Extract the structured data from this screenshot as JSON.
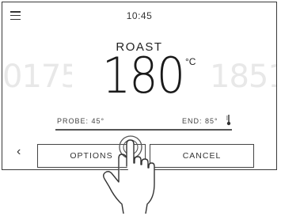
{
  "header": {
    "time": "10:45"
  },
  "mode": "ROAST",
  "temperature": {
    "current": "180",
    "unit": "°C",
    "prev": "0175",
    "next": "1851"
  },
  "probe": {
    "label": "PROBE: 45°",
    "end_label": "END: 85°"
  },
  "buttons": {
    "options": "OPTIONS",
    "cancel": "CANCEL"
  },
  "icons": [
    "menu-icon",
    "thermometer-icon",
    "chevron-left-icon",
    "hand-pointer-icon"
  ]
}
